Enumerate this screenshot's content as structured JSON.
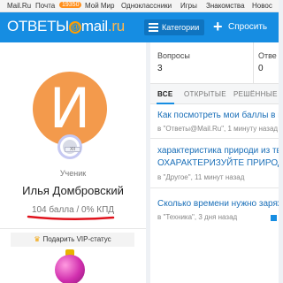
{
  "portal": {
    "items": [
      "Mail.Ru",
      "Почта",
      "Мой Мир",
      "Одноклассники",
      "Игры",
      "Знакомства",
      "Новос"
    ],
    "mail_badge": "19350"
  },
  "header": {
    "logo_left": "ОТВЕТЫ",
    "logo_at": "@",
    "logo_mail": "mail",
    "logo_ru": ".ru",
    "categories_label": "Категории",
    "ask_label": "Спросить",
    "accent_color": "#168de2"
  },
  "profile": {
    "avatar_letter": "И",
    "avatar_color": "#f39a4c",
    "rank_badge": "XII",
    "rank": "Ученик",
    "name": "Илья Домбровский",
    "stats": "104 балла / 0% КПД",
    "vip_label": "Подарить VIP-статус"
  },
  "stats": {
    "questions_label": "Вопросы",
    "questions_value": "3",
    "answers_label": "Отве",
    "answers_value": "0"
  },
  "tabs": [
    "ВСЕ",
    "ОТКРЫТЫЕ",
    "РЕШЁННЫЕ"
  ],
  "questions": [
    {
      "title_lines": [
        "Как посмотреть мои баллы в мо"
      ],
      "meta": "в \"Ответы@Mail.Ru\", 1 минуту назад"
    },
    {
      "title_lines": [
        "характеристика природи из твор",
        "ОХАРАКТЕРИЗУЙТЕ ПРИРОД"
      ],
      "meta": "в \"Другое\", 11 минут назад"
    },
    {
      "title_lines": [
        "Сколько времени нужно заряжа"
      ],
      "meta": "в \"Техника\", 3 дня назад"
    }
  ]
}
